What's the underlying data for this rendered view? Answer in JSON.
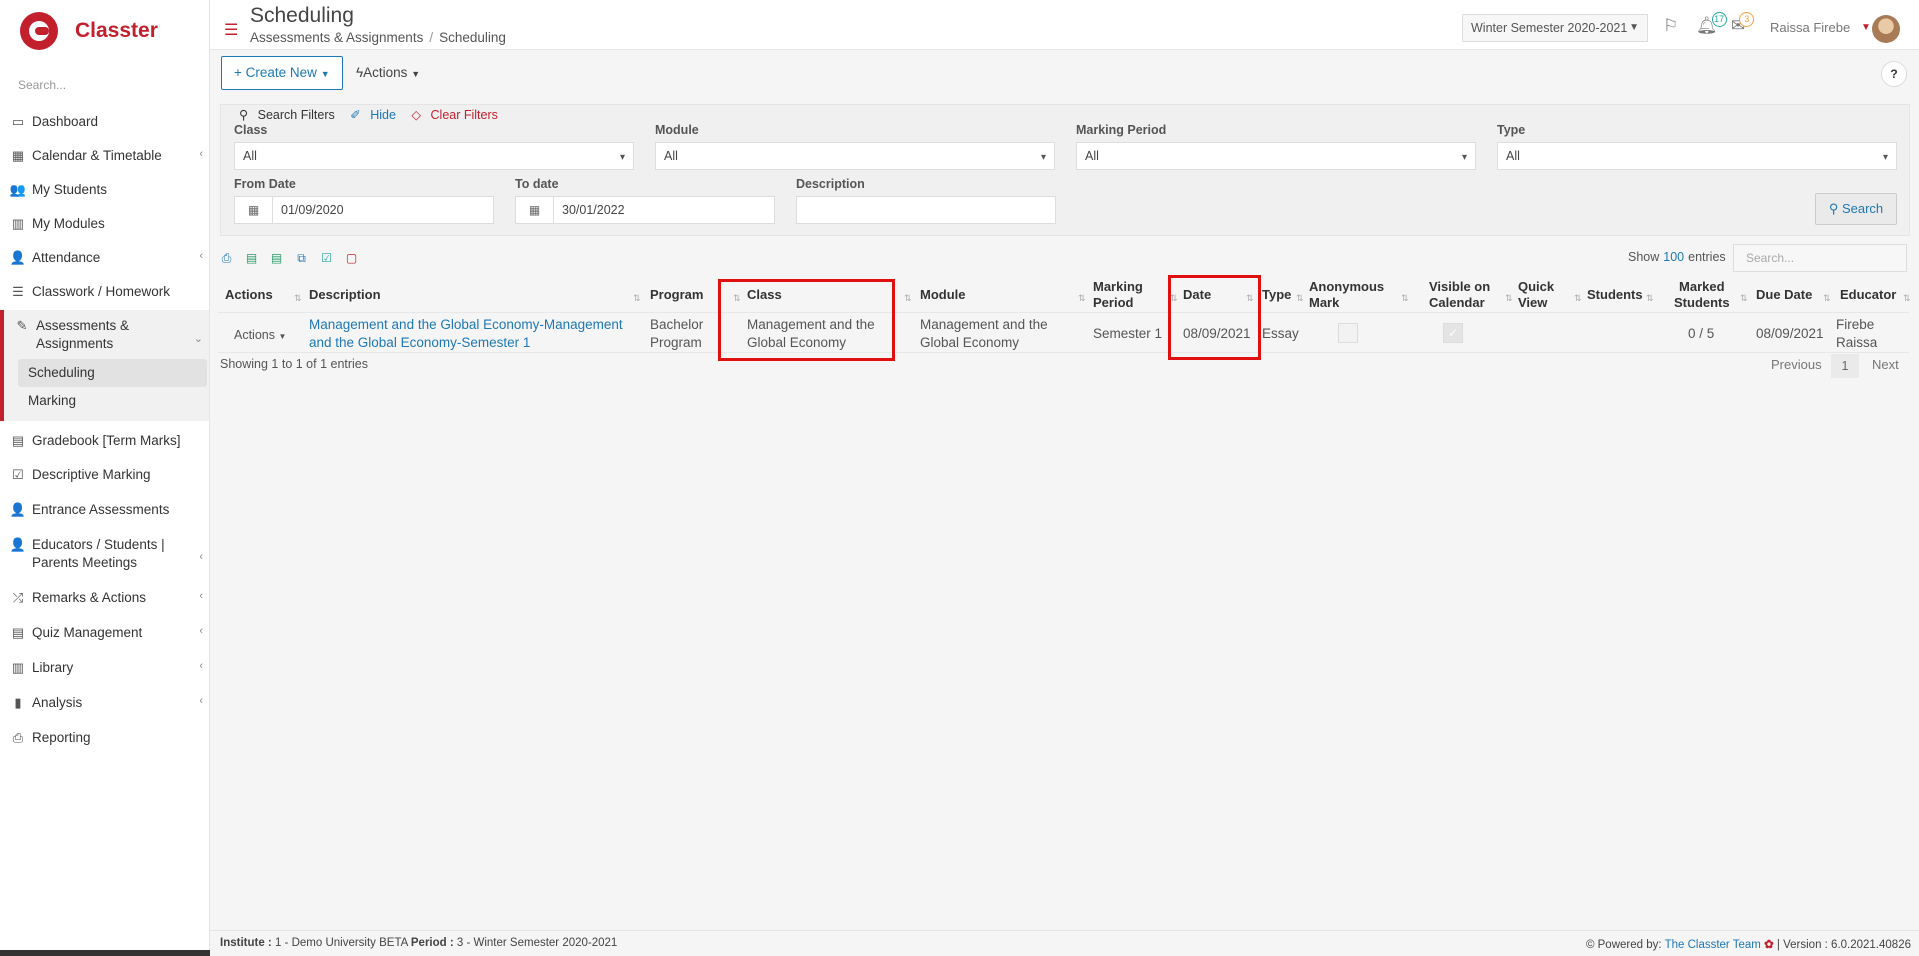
{
  "app": {
    "name": "Classter",
    "search_placeholder": "Search..."
  },
  "sidebar": {
    "items": [
      {
        "label": "Dashboard",
        "icon": "laptop-icon"
      },
      {
        "label": "Calendar & Timetable",
        "icon": "calendar-icon",
        "expandable": true
      },
      {
        "label": "My Students",
        "icon": "users-icon"
      },
      {
        "label": "My Modules",
        "icon": "book-icon"
      },
      {
        "label": "Attendance",
        "icon": "user-check-icon",
        "expandable": true
      },
      {
        "label": "Classwork / Homework",
        "icon": "list-icon"
      },
      {
        "label": "Assessments & Assignments",
        "icon": "edit-icon",
        "expandable": true,
        "active": true
      },
      {
        "label": "Gradebook [Term Marks]",
        "icon": "gradebook-icon"
      },
      {
        "label": "Descriptive Marking",
        "icon": "check-square-icon"
      },
      {
        "label": "Entrance Assessments",
        "icon": "user-edit-icon"
      },
      {
        "label": "Educators / Students | Parents Meetings",
        "icon": "meeting-icon",
        "expandable": true
      },
      {
        "label": "Remarks & Actions",
        "icon": "shuffle-icon",
        "expandable": true
      },
      {
        "label": "Quiz Management",
        "icon": "quiz-icon",
        "expandable": true
      },
      {
        "label": "Library",
        "icon": "library-icon",
        "expandable": true
      },
      {
        "label": "Analysis",
        "icon": "chart-icon",
        "expandable": true
      },
      {
        "label": "Reporting",
        "icon": "print-icon"
      }
    ],
    "sub_items": [
      "Scheduling",
      "Marking"
    ]
  },
  "header": {
    "title": "Scheduling",
    "breadcrumb": [
      "Assessments & Assignments",
      "Scheduling"
    ],
    "semester": "Winter Semester 2020-2021",
    "notifications_count": "17",
    "messages_count": "3",
    "user_name": "Raissa Firebe"
  },
  "toolbar": {
    "create_label": "Create New",
    "actions_label": "Actions",
    "help_label": "?"
  },
  "filters": {
    "search_filters_label": "Search Filters",
    "hide_label": "Hide",
    "clear_label": "Clear Filters",
    "class_label": "Class",
    "class_value": "All",
    "module_label": "Module",
    "module_value": "All",
    "marking_period_label": "Marking Period",
    "marking_period_value": "All",
    "type_label": "Type",
    "type_value": "All",
    "from_date_label": "From Date",
    "from_date_value": "01/09/2020",
    "to_date_label": "To date",
    "to_date_value": "30/01/2022",
    "description_label": "Description",
    "description_value": "",
    "search_button": "Search"
  },
  "table": {
    "show_label": "Show",
    "entries_count": "100",
    "entries_label": "entries",
    "search_placeholder": "Search...",
    "columns": {
      "actions": "Actions",
      "description": "Description",
      "program": "Program",
      "class": "Class",
      "module": "Module",
      "marking_period_1": "Marking",
      "marking_period_2": "Period",
      "date": "Date",
      "type": "Type",
      "anonymous_1": "Anonymous",
      "anonymous_2": "Mark",
      "visible_1": "Visible on",
      "visible_2": "Calendar",
      "quick_1": "Quick",
      "quick_2": "View",
      "students": "Students",
      "marked_1": "Marked",
      "marked_2": "Students",
      "due_date": "Due Date",
      "educator": "Educator"
    },
    "row": {
      "actions": "Actions",
      "description_1": "Management and the Global Economy-Management",
      "description_2": "and the Global Economy-Semester 1",
      "program_1": "Bachelor",
      "program_2": "Program",
      "class_1": "Management and the",
      "class_2": "Global Economy",
      "module_1": "Management and the",
      "module_2": "Global Economy",
      "marking_period": "Semester 1",
      "date": "08/09/2021",
      "type": "Essay",
      "anonymous_mark": false,
      "visible_on_calendar": true,
      "marked_students": "0 / 5",
      "due_date": "08/09/2021",
      "educator_1": "Firebe",
      "educator_2": "Raissa"
    },
    "showing": "Showing 1 to 1 of 1 entries",
    "pagination": {
      "previous": "Previous",
      "page": "1",
      "next": "Next"
    }
  },
  "footer": {
    "institute_label": "Institute :",
    "institute_value": "1 - Demo University BETA",
    "period_label": "Period :",
    "period_value": "3 - Winter Semester 2020-2021",
    "powered_label": "Powered by:",
    "powered_link": "The Classter Team",
    "version": "| Version : 6.0.2021.40826"
  },
  "colors": {
    "brand": "#c3202e",
    "link": "#1e78b4",
    "highlight": "#e01010"
  }
}
